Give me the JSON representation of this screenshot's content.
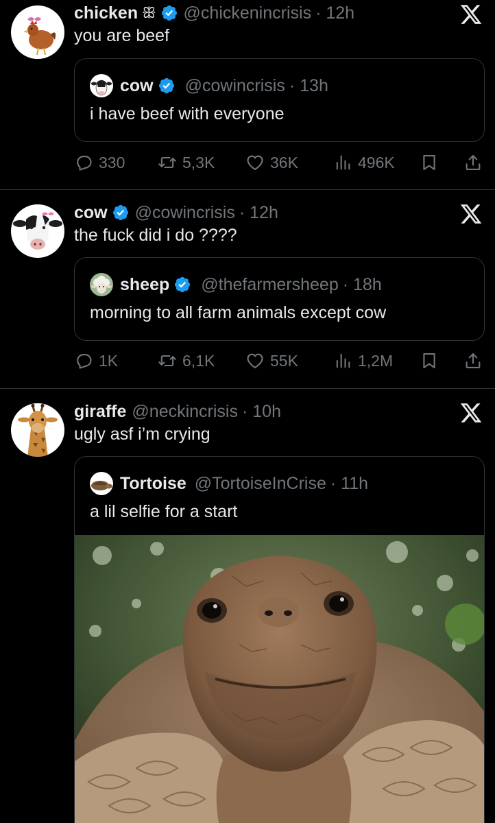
{
  "tweets": [
    {
      "author_name": "chicken",
      "author_emoji": "ꕥ",
      "handle": "@chickenincrisis",
      "time": "· 12h",
      "text": "you are beef",
      "verified": true,
      "quote": {
        "author_name": "cow",
        "handle": "@cowincrisis",
        "time": "· 13h",
        "text": "i have beef with everyone",
        "verified": true
      },
      "stats": {
        "replies": "330",
        "reposts": "5,3K",
        "likes": "36K",
        "views": "496K"
      }
    },
    {
      "author_name": "cow",
      "handle": "@cowincrisis",
      "time": "· 12h",
      "text": "the fuck did i do ????",
      "verified": true,
      "quote": {
        "author_name": "sheep",
        "handle": "@thefarmersheep",
        "time": "· 18h",
        "text": "morning to all farm animals except cow",
        "verified": true
      },
      "stats": {
        "replies": "1K",
        "reposts": "6,1K",
        "likes": "55K",
        "views": "1,2M"
      }
    },
    {
      "author_name": "giraffe",
      "handle": "@neckincrisis",
      "time": "· 10h",
      "text": "ugly asf i’m crying",
      "verified": false,
      "quote": {
        "author_name": "Tortoise",
        "handle": "@TortoiseInCrise",
        "time": "· 11h",
        "text": "a lil selfie for a start",
        "verified": false,
        "has_photo": true
      }
    }
  ],
  "colors": {
    "background": "#000000",
    "text": "#e7e9ea",
    "muted": "#71767b",
    "border": "#2f3336",
    "verified": "#1d9bf0"
  },
  "icons": [
    "x-logo-icon",
    "verified-badge-icon",
    "reply-icon",
    "repost-icon",
    "like-icon",
    "views-icon",
    "bookmark-icon",
    "share-icon"
  ]
}
